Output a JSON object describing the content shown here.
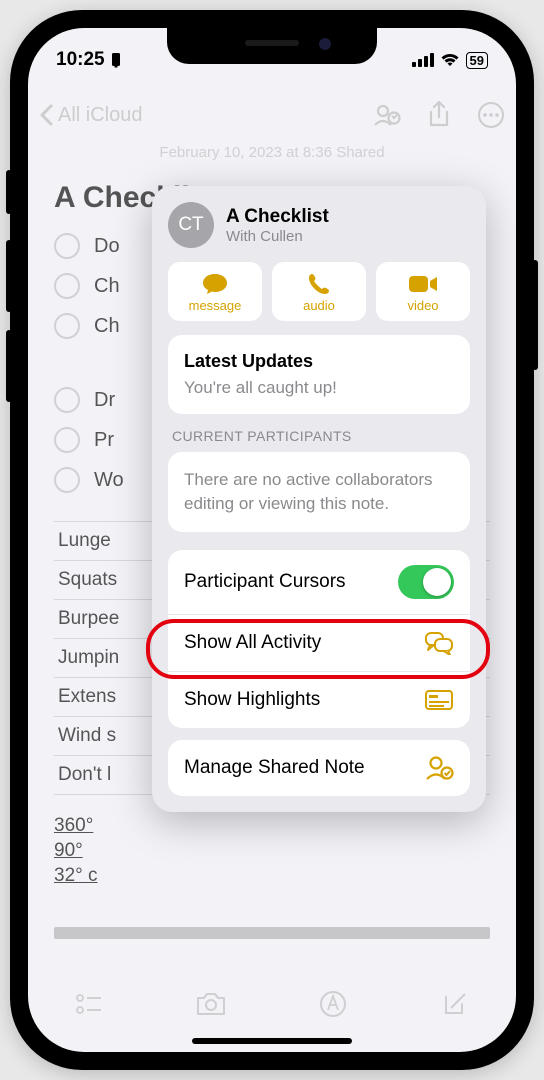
{
  "status": {
    "time": "10:25",
    "battery": "59"
  },
  "nav": {
    "back_label": "All iCloud"
  },
  "note": {
    "timestamp": "February 10, 2023 at 8:36    Shared",
    "title": "A Checklist",
    "checks": [
      "Do",
      "Ch",
      "Ch",
      "Dr",
      "Pr",
      "Wo"
    ],
    "table_rows": [
      "Lunge",
      "Squats",
      "Burpee",
      "Jumpin",
      "Extens",
      "Wind s",
      "Don't l"
    ],
    "misc": [
      "360°",
      "90°",
      "32° c"
    ]
  },
  "popover": {
    "avatar_initials": "CT",
    "title": "A Checklist",
    "subtitle": "With Cullen",
    "contact": {
      "message": "message",
      "audio": "audio",
      "video": "video"
    },
    "updates": {
      "heading": "Latest Updates",
      "body": "You're all caught up!"
    },
    "participants": {
      "label": "CURRENT PARTICIPANTS",
      "body": "There are no active collaborators editing or viewing this note."
    },
    "menu": {
      "cursors": "Participant Cursors",
      "activity": "Show All Activity",
      "highlights": "Show Highlights",
      "manage": "Manage Shared Note"
    }
  }
}
